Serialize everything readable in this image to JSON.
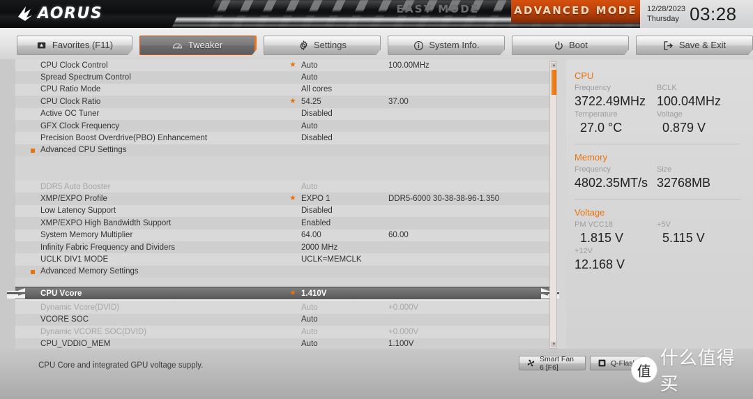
{
  "header": {
    "brand": "AORUS",
    "easy_mode": "EASY MODE",
    "advanced_mode": "ADVANCED MODE",
    "date": "12/28/2023",
    "weekday": "Thursday",
    "time": "03:28",
    "accent_color": "#e8730f"
  },
  "tabs": [
    {
      "label": "Favorites (F11)",
      "icon": "star-box-icon",
      "active": false
    },
    {
      "label": "Tweaker",
      "icon": "gauge-icon",
      "active": true
    },
    {
      "label": "Settings",
      "icon": "gear-icon",
      "active": false
    },
    {
      "label": "System Info.",
      "icon": "info-icon",
      "active": false
    },
    {
      "label": "Boot",
      "icon": "power-icon",
      "active": false
    },
    {
      "label": "Save & Exit",
      "icon": "exit-icon",
      "active": false
    }
  ],
  "groups": [
    {
      "rows": [
        {
          "name": "CPU Clock Control",
          "star": true,
          "value": "Auto",
          "value2": "100.00MHz"
        },
        {
          "name": "Spread Spectrum Control",
          "star": false,
          "value": "Auto",
          "value2": ""
        },
        {
          "name": "CPU Ratio Mode",
          "star": false,
          "value": "All cores",
          "value2": ""
        },
        {
          "name": "CPU Clock Ratio",
          "star": true,
          "value": "54.25",
          "value2": "37.00"
        },
        {
          "name": "Active OC Tuner",
          "star": false,
          "value": "Disabled",
          "value2": ""
        },
        {
          "name": "GFX Clock Frequency",
          "star": false,
          "value": "Auto",
          "value2": ""
        },
        {
          "name": "Precision Boost Overdrive(PBO) Enhancement",
          "star": false,
          "value": "Disabled",
          "value2": ""
        },
        {
          "name": "Advanced CPU Settings",
          "star": false,
          "value": "",
          "value2": "",
          "bullet": true
        }
      ]
    },
    {
      "rows": [
        {
          "name": "DDR5 Auto Booster",
          "star": false,
          "value": "Auto",
          "value2": "",
          "dim": true
        },
        {
          "name": "XMP/EXPO Profile",
          "star": true,
          "value": "EXPO 1",
          "value2": "DDR5-6000 30-38-38-96-1.350"
        },
        {
          "name": "Low Latency Support",
          "star": false,
          "value": "Disabled",
          "value2": ""
        },
        {
          "name": "XMP/EXPO High Bandwidth Support",
          "star": false,
          "value": "Enabled",
          "value2": ""
        },
        {
          "name": "System Memory Multiplier",
          "star": false,
          "value": "64.00",
          "value2": "60.00"
        },
        {
          "name": "Infinity Fabric Frequency and Dividers",
          "star": false,
          "value": "2000 MHz",
          "value2": ""
        },
        {
          "name": "UCLK DIV1 MODE",
          "star": false,
          "value": "UCLK=MEMCLK",
          "value2": ""
        },
        {
          "name": "Advanced Memory Settings",
          "star": false,
          "value": "",
          "value2": "",
          "bullet": true
        }
      ]
    },
    {
      "rows": [
        {
          "name": "CPU Vcore",
          "star": true,
          "value": "1.410V",
          "value2": "",
          "selected": true
        },
        {
          "name": "Dynamic Vcore(DVID)",
          "star": false,
          "value": "Auto",
          "value2": "+0.000V",
          "dim": true
        },
        {
          "name": "VCORE SOC",
          "star": false,
          "value": "Auto",
          "value2": ""
        },
        {
          "name": "Dynamic VCORE SOC(DVID)",
          "star": false,
          "value": "Auto",
          "value2": "+0.000V",
          "dim": true
        },
        {
          "name": "CPU_VDDIO_MEM",
          "star": false,
          "value": "Auto",
          "value2": "1.100V"
        }
      ]
    }
  ],
  "sidebar": {
    "cpu": {
      "title": "CPU",
      "frequency_label": "Frequency",
      "frequency_value": "3722.49MHz",
      "bclk_label": "BCLK",
      "bclk_value": "100.04MHz",
      "temperature_label": "Temperature",
      "temperature_value": "27.0 °C",
      "voltage_label": "Voltage",
      "voltage_value": "0.879 V"
    },
    "memory": {
      "title": "Memory",
      "frequency_label": "Frequency",
      "frequency_value": "4802.35MT/s",
      "size_label": "Size",
      "size_value": "32768MB"
    },
    "voltage": {
      "title": "Voltage",
      "pmvcc18_label": "PM VCC18",
      "pmvcc18_value": "1.815 V",
      "p5v_label": "+5V",
      "p5v_value": "5.115 V",
      "p12v_label": "+12V",
      "p12v_value": "12.168 V"
    }
  },
  "footer": {
    "help_text": "CPU Core and integrated GPU voltage supply.",
    "smart_fan": "Smart Fan 6 [F6]",
    "q_flash": "Q-Flash",
    "watermark_mark": "值",
    "watermark_text": "什么值得买"
  }
}
